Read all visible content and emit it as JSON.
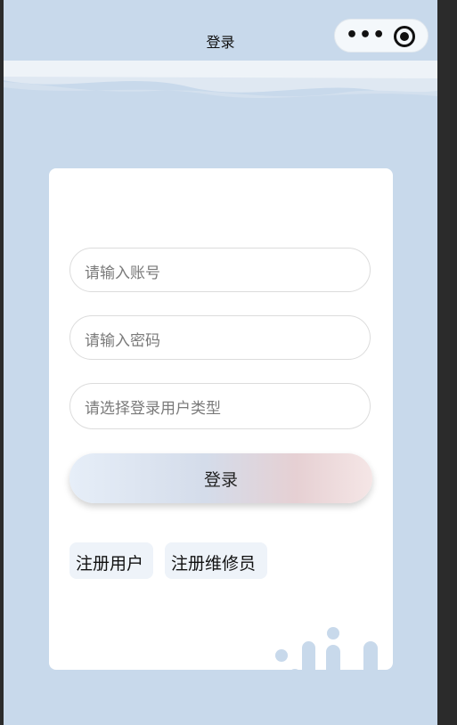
{
  "nav": {
    "title": "登录",
    "more_icon": "more-dots-icon",
    "close_icon": "mini-program-close-icon"
  },
  "form": {
    "account_placeholder": "请输入账号",
    "password_placeholder": "请输入密码",
    "user_type_placeholder": "请选择登录用户类型",
    "login_label": "登录"
  },
  "links": {
    "register_user": "注册用户",
    "register_repairer": "注册维修员"
  },
  "colors": {
    "background": "#c8d9eb",
    "card": "#ffffff",
    "accent_pink": "#f5e6e6"
  }
}
